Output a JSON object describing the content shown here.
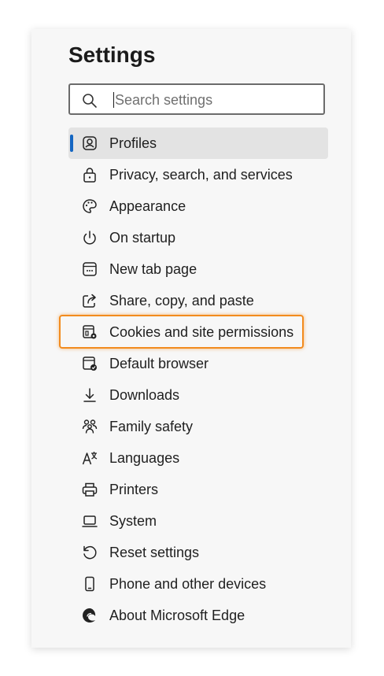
{
  "settings": {
    "title": "Settings",
    "search": {
      "placeholder": "Search settings",
      "value": ""
    },
    "accent": "#1466c2",
    "highlight_color": "#f28b1e",
    "items": [
      {
        "label": "Profiles",
        "icon": "profile-icon",
        "active": true
      },
      {
        "label": "Privacy, search, and services",
        "icon": "lock-icon"
      },
      {
        "label": "Appearance",
        "icon": "palette-icon"
      },
      {
        "label": "On startup",
        "icon": "power-icon"
      },
      {
        "label": "New tab page",
        "icon": "new-tab-icon"
      },
      {
        "label": "Share, copy, and paste",
        "icon": "share-icon"
      },
      {
        "label": "Cookies and site permissions",
        "icon": "cookies-permissions-icon",
        "highlighted": true
      },
      {
        "label": "Default browser",
        "icon": "default-browser-icon"
      },
      {
        "label": "Downloads",
        "icon": "download-icon"
      },
      {
        "label": "Family safety",
        "icon": "family-icon"
      },
      {
        "label": "Languages",
        "icon": "languages-icon"
      },
      {
        "label": "Printers",
        "icon": "printer-icon"
      },
      {
        "label": "System",
        "icon": "laptop-icon"
      },
      {
        "label": "Reset settings",
        "icon": "reset-icon"
      },
      {
        "label": "Phone and other devices",
        "icon": "phone-icon"
      },
      {
        "label": "About Microsoft Edge",
        "icon": "edge-logo-icon"
      }
    ]
  }
}
